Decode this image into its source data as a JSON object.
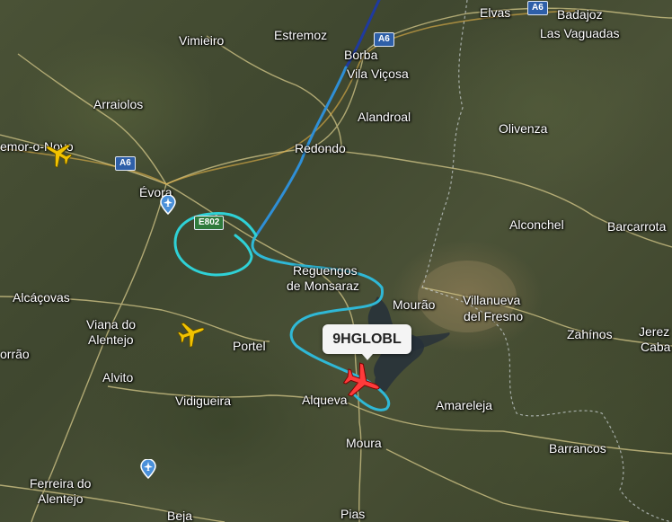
{
  "flight": {
    "callsign": "9HGLOBL",
    "track_colors": [
      "#1f3a9e",
      "#2f8fd6",
      "#2fd1d6"
    ],
    "selected_color": "#ff3b3b",
    "other_color": "#f2c200"
  },
  "places": {
    "elvas": "Elvas",
    "badajoz": "Badajoz",
    "las_vaguadas": "Las Vaguadas",
    "vimieiro": "Vimieiro",
    "estremoz": "Estremoz",
    "borba": "Borba",
    "vila_vicosa": "Vila Viçosa",
    "arraiolos": "Arraiolos",
    "alandroal": "Alandroal",
    "olivenza": "Olivenza",
    "montemor": "emor-o-Novo",
    "redondo": "Redondo",
    "evora": "Évora",
    "alconchel": "Alconchel",
    "barcarrota": "Barcarrota",
    "reguengos_1": "Reguengos",
    "reguengos_2": "de Monsaraz",
    "mourao": "Mourão",
    "villanueva_1": "Villanueva",
    "villanueva_2": "del Fresno",
    "alcacovas": "Alcáçovas",
    "viana_1": "Viana do",
    "viana_2": "Alentejo",
    "portel": "Portel",
    "zahinos": "Zahínos",
    "jerez_1": "Jerez",
    "jerez_2": "Caba",
    "torrao": "orrão",
    "alvito": "Alvito",
    "vidigueira": "Vidigueira",
    "alqueva": "Alqueva",
    "amareleja": "Amareleja",
    "moura": "Moura",
    "barrancos": "Barrancos",
    "ferreira_1": "Ferreira do",
    "ferreira_2": "Alentejo",
    "beja": "Beja",
    "pias": "Pias"
  },
  "roads": {
    "a6_top": "A6",
    "a6_mid": "A6",
    "a6_left": "A6",
    "e802": "E802"
  }
}
